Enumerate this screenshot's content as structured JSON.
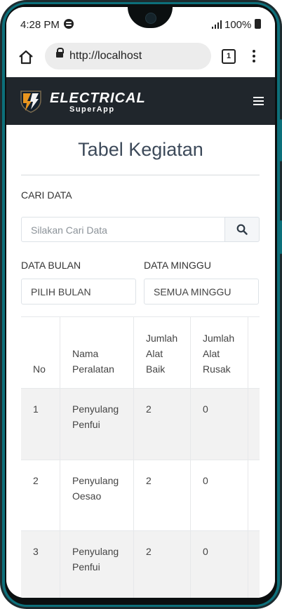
{
  "status_bar": {
    "time": "4:28 PM",
    "battery": "100%"
  },
  "browser": {
    "url": "http://localhost",
    "tab_count": "1"
  },
  "app": {
    "brand_title": "ELECTRICAL",
    "brand_subtitle": "SuperApp"
  },
  "page": {
    "title": "Tabel Kegiatan",
    "search_label": "CARI DATA",
    "search_placeholder": "Silakan Cari Data",
    "month_label": "DATA BULAN",
    "month_value": "PILIH BULAN",
    "week_label": "DATA MINGGU",
    "week_value": "SEMUA MINGGU"
  },
  "table": {
    "headers": [
      "No",
      "Nama\nPeralatan",
      "Jumlah\nAlat\nBaik",
      "Jumlah\nAlat\nRusak"
    ],
    "rows": [
      [
        "1",
        "Penyulang\nPenfui",
        "2",
        "0"
      ],
      [
        "2",
        "Penyulang\nOesao",
        "2",
        "0"
      ],
      [
        "3",
        "Penyulang\nPenfui",
        "2",
        "0"
      ]
    ]
  },
  "colors": {
    "navbar": "#20262c",
    "accent": "#0c6f7a",
    "title": "#3d4a5a",
    "logo_orange": "#e8951f"
  }
}
